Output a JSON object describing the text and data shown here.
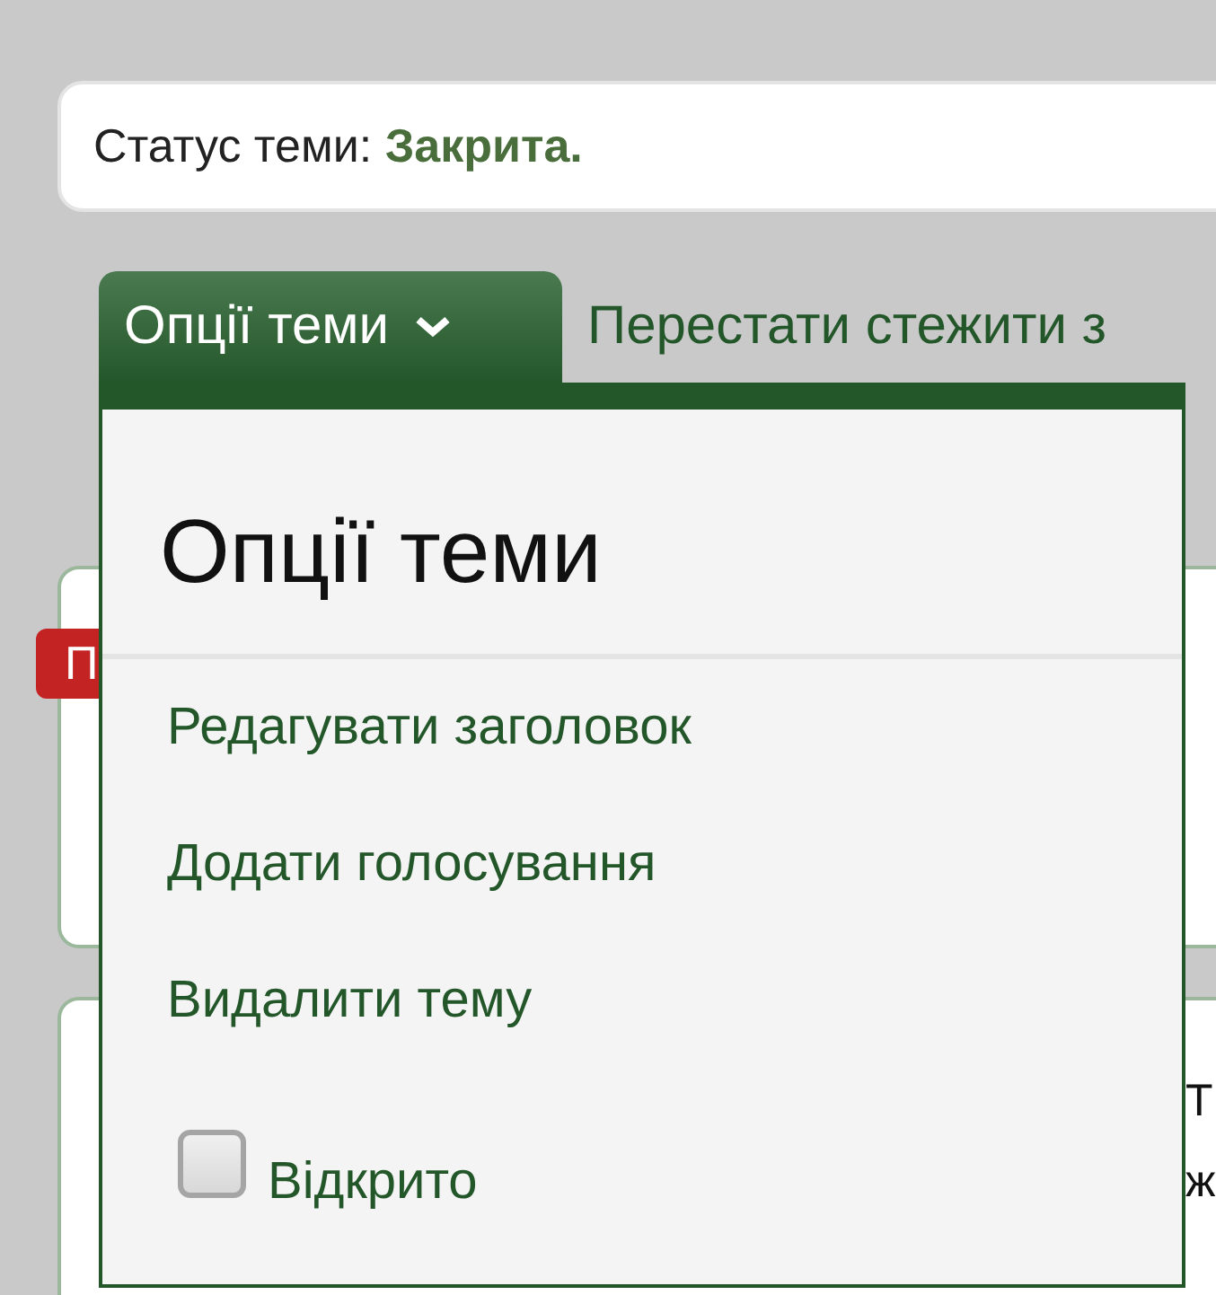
{
  "status": {
    "label": "Статус теми:",
    "value": "Закрита."
  },
  "tabs": [
    {
      "label": "Опції теми",
      "selected": true
    },
    {
      "label": "Перестати стежити з",
      "selected": false
    }
  ],
  "post": {
    "badge": "П"
  },
  "post_body": {
    "lines": [
      "Т",
      "ж"
    ]
  },
  "menu": {
    "title": "Опції теми",
    "items": [
      {
        "label": "Редагувати заголовок"
      },
      {
        "label": "Додати голосування"
      },
      {
        "label": "Видалити тему"
      }
    ],
    "checkbox": {
      "label": "Відкрито",
      "checked": false
    }
  }
}
